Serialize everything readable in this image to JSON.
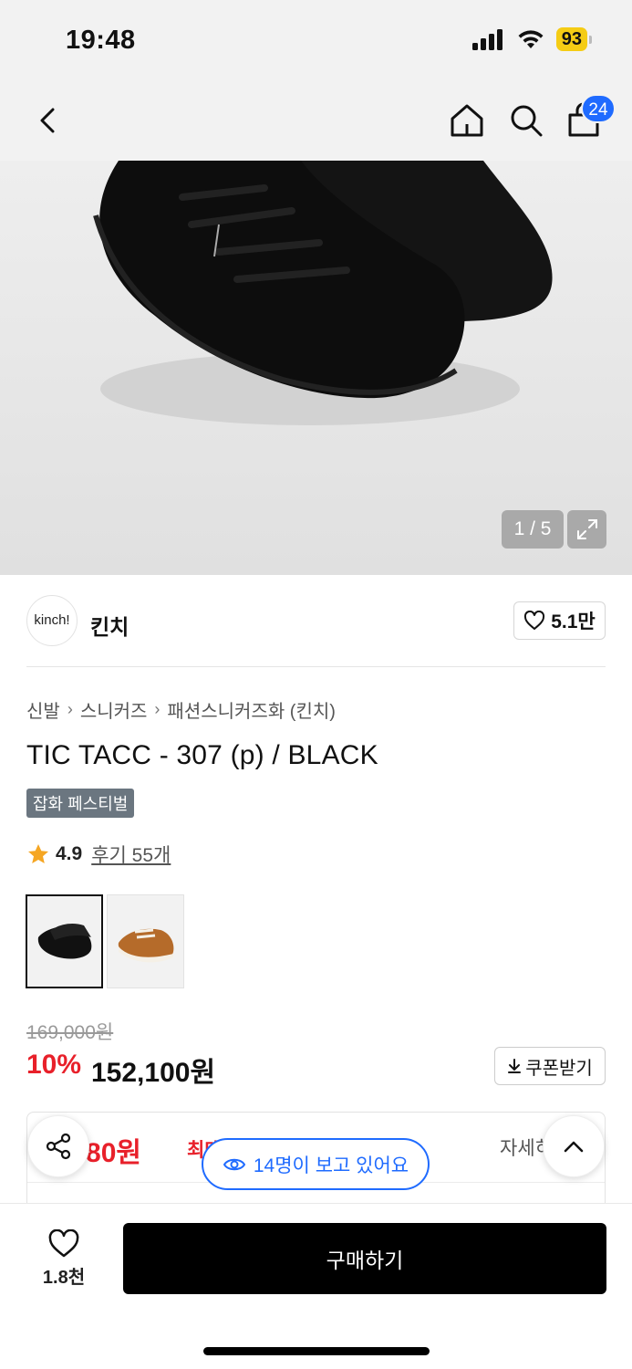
{
  "status_bar": {
    "time": "19:48",
    "battery": "93"
  },
  "nav": {
    "cart_count": "24"
  },
  "hero": {
    "counter": "1 / 5"
  },
  "brand": {
    "logo_text": "kinch!",
    "name": "킨치",
    "likes": "5.1만"
  },
  "breadcrumb": {
    "items": [
      "신발",
      "스니커즈",
      "패션스니커즈화 (킨치)"
    ]
  },
  "product": {
    "title": "TIC TACC - 307 (p) / BLACK",
    "promo_tag": "잡화 페스티벌",
    "rating": "4.9",
    "review_link": "후기 55개"
  },
  "colors": {
    "options": [
      "black",
      "brown"
    ],
    "selected": "black"
  },
  "price": {
    "original": "169,000원",
    "discount": "10%",
    "sale": "152,100원",
    "coupon_label": "쿠폰받기"
  },
  "benefit": {
    "price_fragment": ",680원",
    "label_fragment": "최대",
    "detail_fragment": "자세히"
  },
  "viewers": {
    "text": "14명이 보고 있어요"
  },
  "bottom": {
    "wish_count": "1.8천",
    "buy_label": "구매하기"
  },
  "colors_ui": {
    "accent_blue": "#1f6bff",
    "sale_red": "#e8202a",
    "battery_yellow": "#f5cc14"
  }
}
